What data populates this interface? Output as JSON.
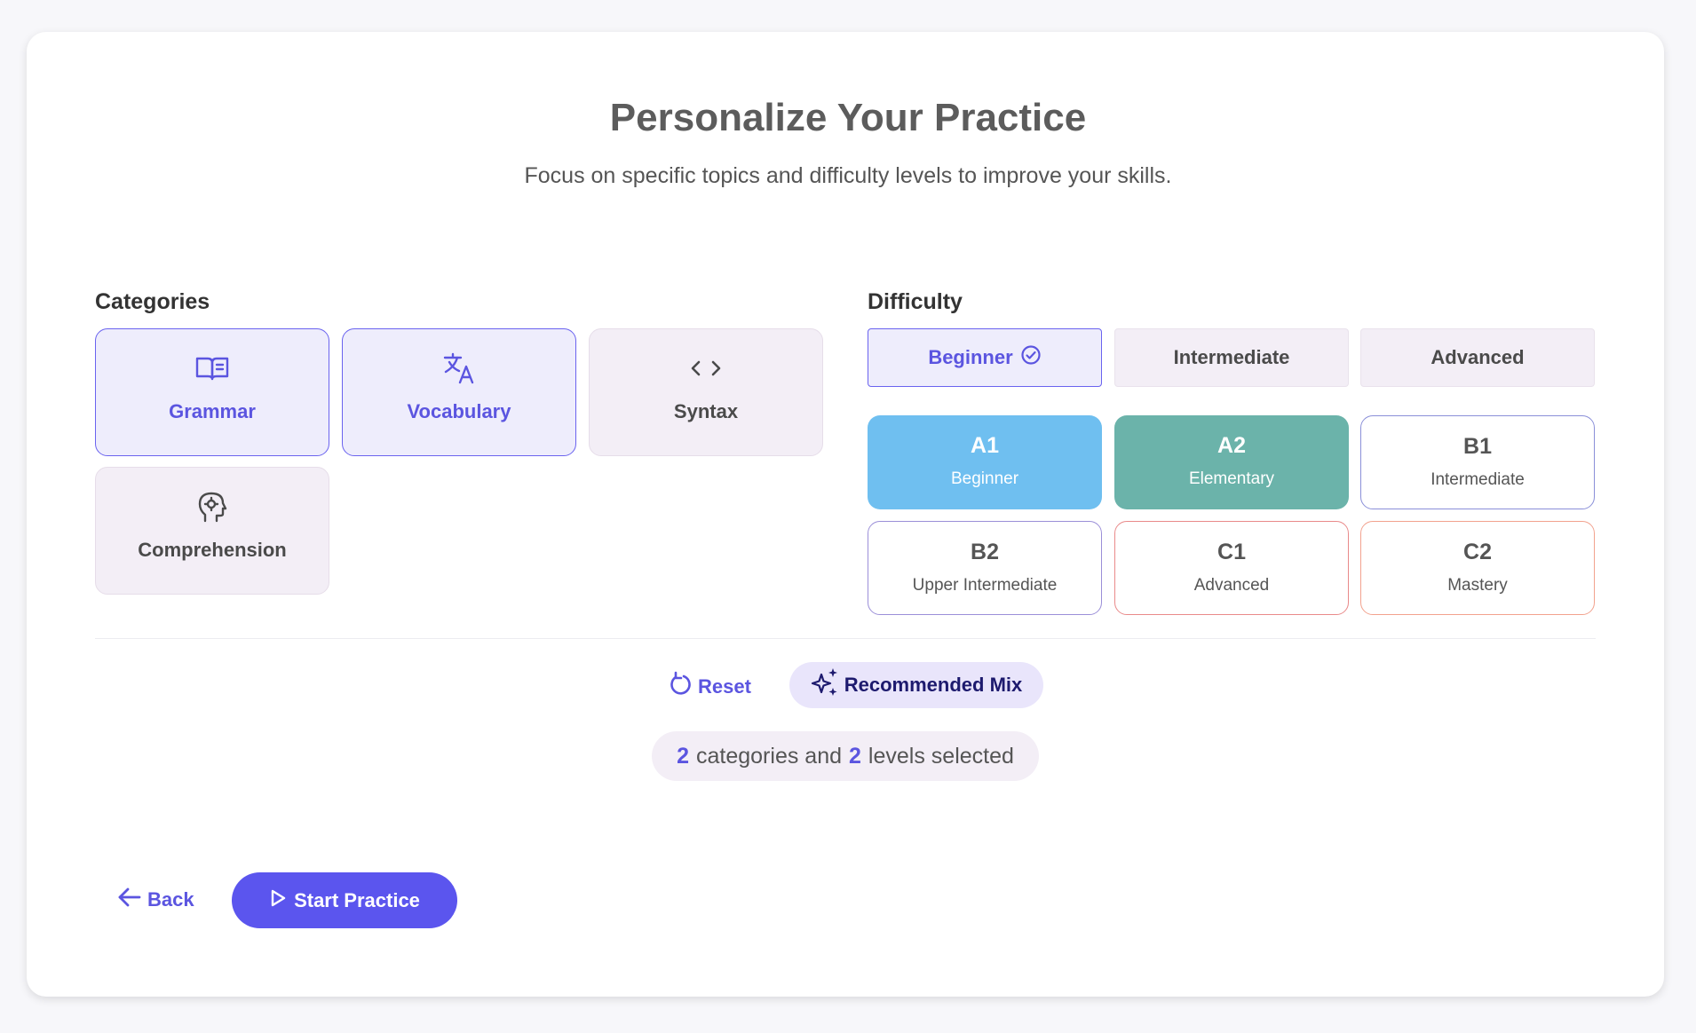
{
  "header": {
    "title": "Personalize Your Practice",
    "subtitle": "Focus on specific topics and difficulty levels to improve your skills."
  },
  "categories": {
    "label": "Categories",
    "items": [
      {
        "label": "Grammar",
        "icon": "book-icon",
        "selected": true
      },
      {
        "label": "Vocabulary",
        "icon": "translate-icon",
        "selected": true
      },
      {
        "label": "Syntax",
        "icon": "code-icon",
        "selected": false
      },
      {
        "label": "Comprehension",
        "icon": "brain-head-icon",
        "selected": false
      }
    ]
  },
  "difficulty": {
    "label": "Difficulty",
    "tabs": [
      {
        "label": "Beginner",
        "selected": true
      },
      {
        "label": "Intermediate",
        "selected": false
      },
      {
        "label": "Advanced",
        "selected": false
      }
    ],
    "levels": [
      {
        "code": "A1",
        "name": "Beginner",
        "selected": true,
        "color": "#6fbff0"
      },
      {
        "code": "A2",
        "name": "Elementary",
        "selected": true,
        "color": "#6bb3aa"
      },
      {
        "code": "B1",
        "name": "Intermediate",
        "selected": false,
        "color": "#8a8fd8"
      },
      {
        "code": "B2",
        "name": "Upper Intermediate",
        "selected": false,
        "color": "#9b8fd8"
      },
      {
        "code": "C1",
        "name": "Advanced",
        "selected": false,
        "color": "#e98a8a"
      },
      {
        "code": "C2",
        "name": "Mastery",
        "selected": false,
        "color": "#f2a28e"
      }
    ]
  },
  "actions": {
    "reset_label": "Reset",
    "mix_label": "Recommended Mix"
  },
  "summary": {
    "categories_count": "2",
    "middle_text": "categories and",
    "levels_count": "2",
    "end_text": "levels selected"
  },
  "footer": {
    "back_label": "Back",
    "start_label": "Start Practice"
  },
  "colors": {
    "accent": "#5b55ee",
    "selected_bg": "#eeedfc",
    "tile_bg": "#f3eef6"
  }
}
